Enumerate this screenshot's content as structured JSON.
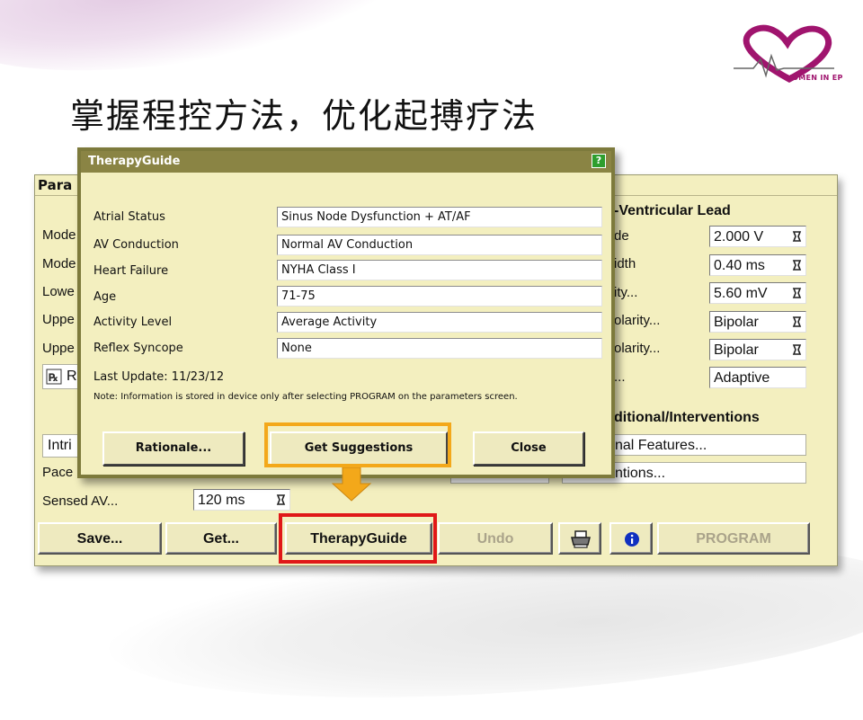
{
  "slide": {
    "title": "掌握程控方法，优化起搏疗法",
    "logo_text": "WOMEN IN EP"
  },
  "colors": {
    "panel_bg": "#f3efbf",
    "dialog_title_bg": "#8a8444",
    "highlight_orange": "#f3a81a",
    "highlight_red": "#e01818",
    "arrow_fill": "#f3a81a",
    "logo_magenta": "#a0146e"
  },
  "background_window": {
    "title": "Para",
    "left_labels": [
      "Mode",
      "Mode",
      "Lowe",
      "Uppe",
      "Uppe"
    ],
    "rx_label": "R",
    "intrinsic_label": "Intri",
    "pace_label": "Pace",
    "sensed_av_label": "Sensed AV...",
    "sensed_av_value": "120 ms",
    "ventricular": {
      "heading": "-Ventricular Lead",
      "rows": [
        {
          "label": "de",
          "value": "2.000 V",
          "knob": true
        },
        {
          "label": "idth",
          "value": "0.40 ms",
          "knob": true
        },
        {
          "label": "ity...",
          "value": "5.60 mV",
          "knob": true
        },
        {
          "label": "olarity...",
          "value": "Bipolar",
          "knob": true
        },
        {
          "label": "olarity...",
          "value": "Bipolar",
          "knob": true
        },
        {
          "label": "...",
          "value": "Adaptive",
          "knob": false
        }
      ]
    },
    "additional": {
      "heading": "ditional/Interventions",
      "items": [
        "nal Features...",
        "ntions..."
      ]
    },
    "buttons": {
      "save": "Save...",
      "get": "Get...",
      "therapy_guide": "TherapyGuide",
      "undo": "Undo",
      "program": "PROGRAM"
    },
    "icons": [
      "printer-icon",
      "info-icon"
    ]
  },
  "dialog": {
    "title": "TherapyGuide",
    "help": "?",
    "rows": [
      {
        "label": "Atrial Status",
        "value": "Sinus Node Dysfunction + AT/AF"
      },
      {
        "label": "AV Conduction",
        "value": "Normal AV Conduction"
      },
      {
        "label": "Heart Failure",
        "value": "NYHA Class I"
      },
      {
        "label": "Age",
        "value": "71-75"
      },
      {
        "label": "Activity Level",
        "value": "Average Activity"
      },
      {
        "label": "Reflex Syncope",
        "value": "None"
      }
    ],
    "last_update": "Last Update: 11/23/12",
    "note": "Note: Information is stored in device only after selecting PROGRAM on the parameters screen.",
    "buttons": {
      "rationale": "Rationale...",
      "get_suggestions": "Get Suggestions",
      "close": "Close"
    }
  }
}
